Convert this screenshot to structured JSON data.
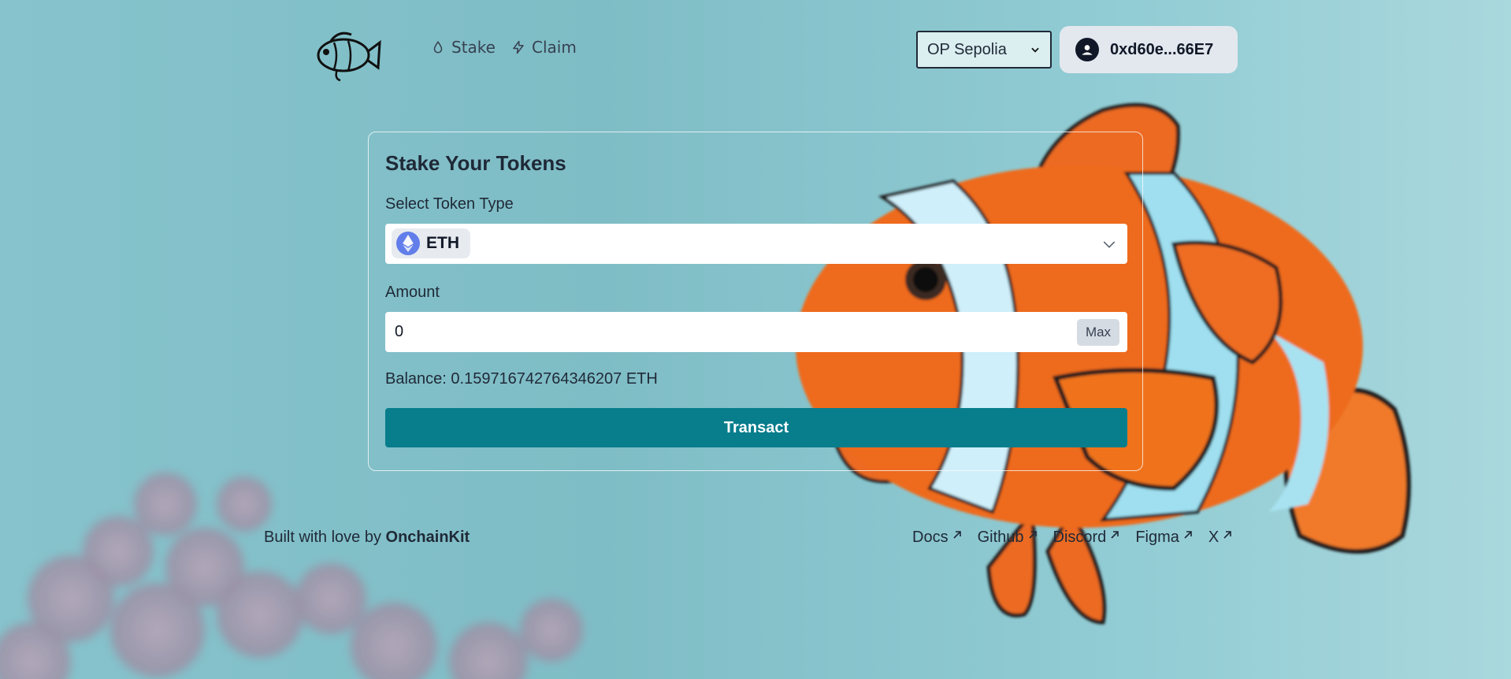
{
  "header": {
    "nav": [
      {
        "label": "Stake",
        "icon": "drop-icon"
      },
      {
        "label": "Claim",
        "icon": "lightning-icon"
      }
    ],
    "network": {
      "selected": "OP Sepolia"
    },
    "wallet": {
      "address": "0xd60e...66E7",
      "icon": "user-avatar-icon"
    }
  },
  "stake_card": {
    "title": "Stake Your Tokens",
    "token_label": "Select Token Type",
    "token": {
      "symbol": "ETH",
      "icon": "ethereum-icon"
    },
    "amount_label": "Amount",
    "amount_value": "0",
    "max_label": "Max",
    "balance": "Balance: 0.159716742764346207 ETH",
    "submit_label": "Transact"
  },
  "footer": {
    "credit_prefix": "Built with love by",
    "credit_brand": "OnchainKit",
    "links": [
      "Docs",
      "Github",
      "Discord",
      "Figma",
      "X"
    ]
  },
  "colors": {
    "accent": "#087d8c",
    "background": "#86c3cc",
    "fish_orange": "#f06a1f"
  }
}
